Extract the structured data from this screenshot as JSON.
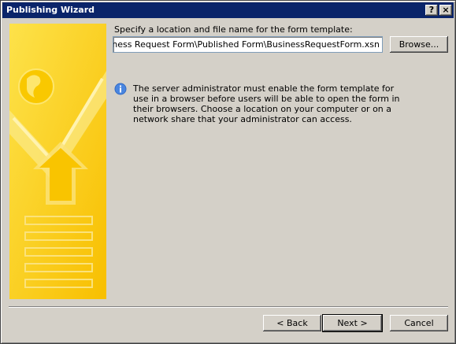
{
  "window": {
    "title": "Publishing Wizard",
    "help_glyph": "?",
    "close_glyph": "×"
  },
  "location": {
    "label": "Specify a location and file name for the form template:",
    "path_value": "cop\\Business Request Form\\Published Form\\BusinessRequestForm.xsn",
    "browse_label": "Browse..."
  },
  "info": {
    "icon": "info-icon",
    "text": "The server administrator must enable the form template for use in a browser before users will be able to open the form in their browsers. Choose a location on your computer or on a network share that your administrator can access."
  },
  "footer": {
    "back_label": "< Back",
    "next_label": "Next >",
    "cancel_label": "Cancel"
  },
  "colors": {
    "titlebar": "#0a246a",
    "art_yellow": "#fcd20a",
    "info_blue": "#316ac5"
  }
}
